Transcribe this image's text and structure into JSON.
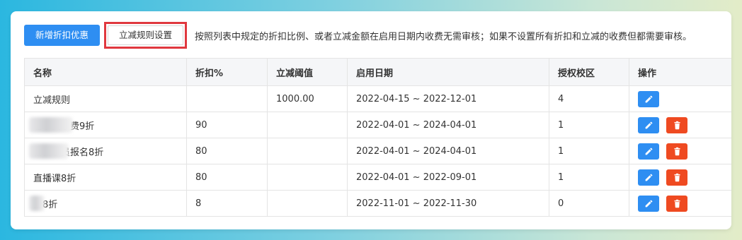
{
  "toolbar": {
    "add_label": "新增折扣优惠",
    "rule_label": "立减规则设置",
    "hint": "按照列表中规定的折扣比例、或者立减金额在启用日期内收费无需审核；如果不设置所有折扣和立减的收费但都需要审核。"
  },
  "table": {
    "headers": [
      "名称",
      "折扣%",
      "立减阈值",
      "启用日期",
      "授权校区",
      "操作"
    ],
    "rows": [
      {
        "name": "立减规则",
        "discount": "",
        "threshold": "1000.00",
        "date": "2022-04-15 ~ 2022-12-01",
        "campus": "4",
        "has_delete": false
      },
      {
        "name": "老学员续费9折",
        "discount": "90",
        "threshold": "",
        "date": "2022-04-01 ~ 2024-04-01",
        "campus": "1",
        "has_delete": true
      },
      {
        "name": "新新学员报名8折",
        "discount": "80",
        "threshold": "",
        "date": "2022-04-01 ~ 2024-04-01",
        "campus": "1",
        "has_delete": true
      },
      {
        "name": "直播课8折",
        "discount": "80",
        "threshold": "",
        "date": "2022-04-01 ~ 2022-09-01",
        "campus": "1",
        "has_delete": true
      },
      {
        "name": "折8折",
        "discount": "8",
        "threshold": "",
        "date": "2022-11-01 ~ 2022-11-30",
        "campus": "0",
        "has_delete": true
      }
    ]
  },
  "icons": {
    "edit": "pencil-icon",
    "delete": "trash-icon"
  },
  "colors": {
    "primary": "#2e8ef2",
    "danger": "#ef4a21",
    "highlight": "#e0383e"
  }
}
